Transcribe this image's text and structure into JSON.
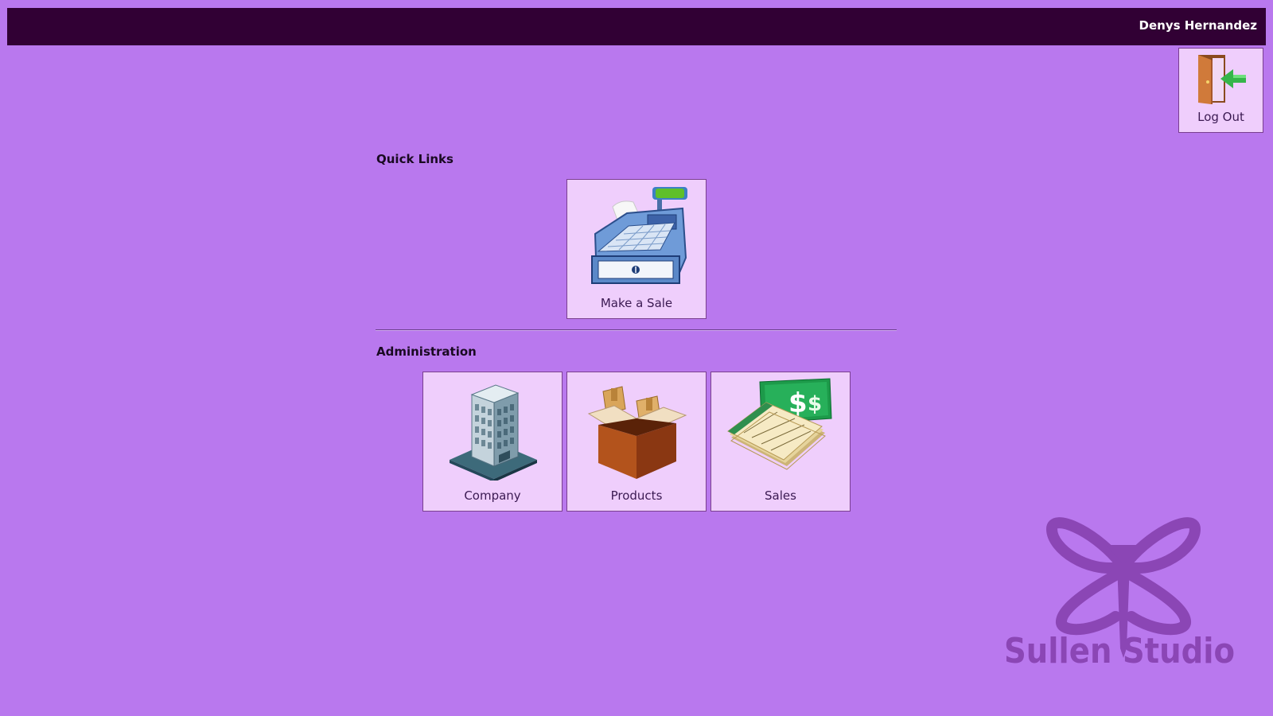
{
  "header": {
    "user_name": "Denys Hernandez"
  },
  "logout": {
    "label": "Log Out",
    "icon": "door-exit-icon"
  },
  "quick_links": {
    "title": "Quick Links",
    "items": [
      {
        "label": "Make a Sale",
        "icon": "cash-register-icon"
      }
    ]
  },
  "administration": {
    "title": "Administration",
    "items": [
      {
        "label": "Company",
        "icon": "office-building-icon"
      },
      {
        "label": "Products",
        "icon": "product-box-icon"
      },
      {
        "label": "Sales",
        "icon": "money-cheque-icon"
      }
    ]
  },
  "brand": {
    "name": "Sullen Studio"
  },
  "colors": {
    "background": "#b978ee",
    "header": "#310034",
    "tile": "#efcefc",
    "brand_mark": "#8b46b5"
  }
}
